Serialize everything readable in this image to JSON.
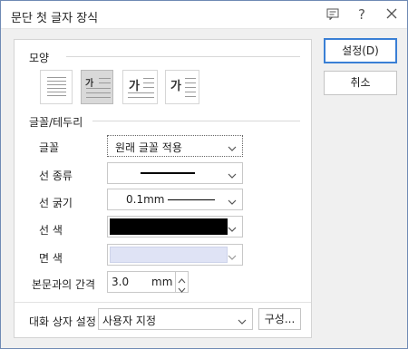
{
  "window": {
    "title": "문단 첫 글자 장식"
  },
  "shape_section": {
    "label": "모양",
    "options": [
      {
        "name": "none",
        "glyph": ""
      },
      {
        "name": "two-lines",
        "glyph": "가"
      },
      {
        "name": "three-lines",
        "glyph": "가"
      },
      {
        "name": "margin",
        "glyph": "가"
      }
    ]
  },
  "font_section": {
    "label": "글꼴/테두리",
    "font_label": "글꼴",
    "font_value": "원래 글꼴 적용",
    "line_type_label": "선 종류",
    "line_width_label": "선 굵기",
    "line_width_value": "0.1mm",
    "line_color_label": "선 색",
    "line_color": "#000000",
    "fill_color_label": "면 색",
    "fill_color": "#dfe3f5",
    "spacing_label": "본문과의 간격",
    "spacing_value": "3.0",
    "spacing_unit": "mm"
  },
  "dialog_settings": {
    "label": "대화 상자 설정",
    "value": "사용자 지정",
    "configure_label": "구성..."
  },
  "buttons": {
    "ok_label": "설정(D)",
    "cancel_label": "취소"
  }
}
